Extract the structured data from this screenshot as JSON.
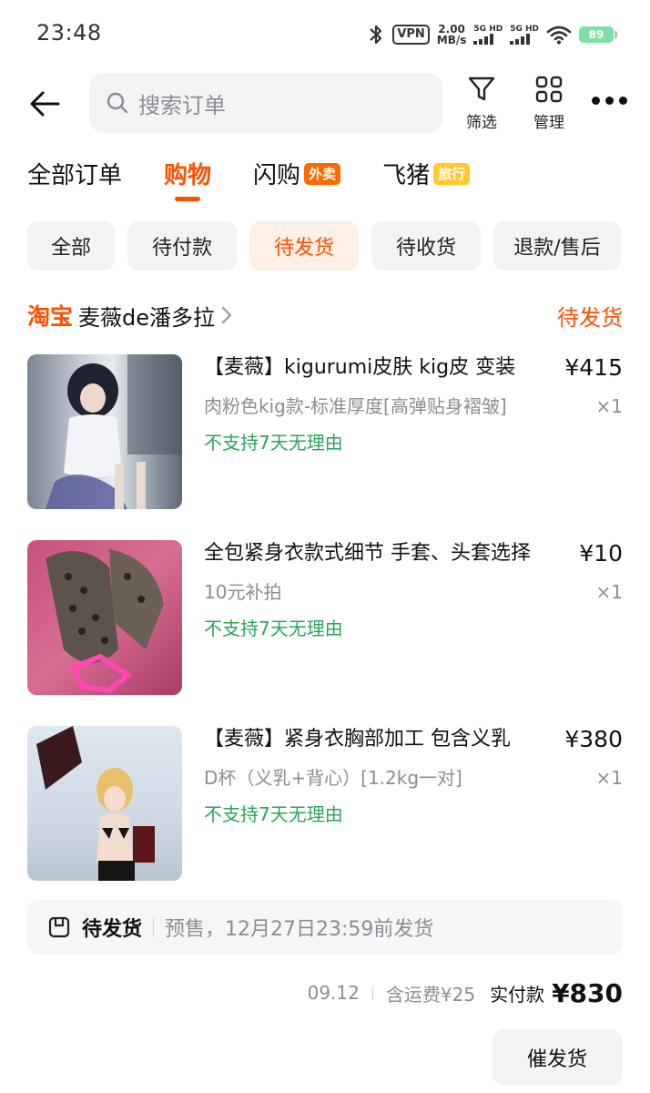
{
  "status_bar": {
    "time": "23:48",
    "vpn": "VPN",
    "speed_value": "2.00",
    "speed_unit": "MB/s",
    "signal1_label": "5G HD",
    "signal2_label": "5G HD",
    "battery": "89"
  },
  "header": {
    "search_placeholder": "搜索订单",
    "filter_label": "筛选",
    "manage_label": "管理"
  },
  "tabs": [
    {
      "label": "全部订单",
      "badge": ""
    },
    {
      "label": "购物",
      "badge": ""
    },
    {
      "label": "闪购",
      "badge": "外卖"
    },
    {
      "label": "飞猪",
      "badge": "旅行"
    }
  ],
  "active_tab": "购物",
  "filters": [
    "全部",
    "待付款",
    "待发货",
    "待收货",
    "退款/售后"
  ],
  "active_filter": "待发货",
  "order": {
    "platform": "淘宝",
    "shop_name": "麦薇de潘多拉",
    "status": "待发货",
    "items": [
      {
        "title": "【麦薇】kigurumi皮肤 kig皮 变装",
        "price": "¥415",
        "sku": "肉粉色kig款-标准厚度[高弹贴身褶皱]",
        "qty": "×1",
        "policy": "不支持7天无理由"
      },
      {
        "title": "全包紧身衣款式细节 手套、头套选择",
        "price": "¥10",
        "sku": "10元补拍",
        "qty": "×1",
        "policy": "不支持7天无理由"
      },
      {
        "title": "【麦薇】紧身衣胸部加工 包含义乳",
        "price": "¥380",
        "sku": "D杯（义乳+背心）[1.2kg一对]",
        "qty": "×1",
        "policy": "不支持7天无理由"
      }
    ],
    "shipping_status": "待发货",
    "shipping_note": "预售，12月27日23:59前发货",
    "date": "09.12",
    "shipping_fee": "含运费¥25",
    "paid_label": "实付款",
    "paid_amount": "¥830",
    "action_button": "催发货"
  },
  "colors": {
    "accent": "#ff5000",
    "green": "#2aa55b",
    "muted": "#8a8d93",
    "chip_bg": "#f2f3f5"
  }
}
